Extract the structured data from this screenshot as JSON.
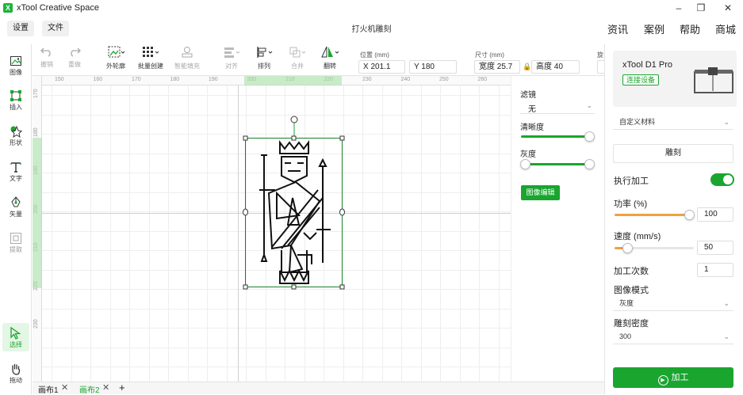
{
  "app": {
    "title": "xTool Creative Space",
    "logo_letter": "X"
  },
  "menubar": {
    "settings_label": "设置",
    "file_label": "文件",
    "document_title": "打火机雕刻",
    "links": [
      "资讯",
      "案例",
      "帮助",
      "商城"
    ]
  },
  "toolbar": {
    "undo_label": "撤销",
    "redo_label": "重做",
    "outline_label": "外轮廓",
    "batch_label": "批量创建",
    "smart_fill_label": "智能填充",
    "align_label": "对齐",
    "arrange_label": "排列",
    "combine_label": "合并",
    "flip_label": "翻转",
    "position_label": "位置 (mm)",
    "x_value": "X 201.1",
    "y_value": "Y 180",
    "size_label": "尺寸 (mm)",
    "width_value": "宽度 25.7",
    "height_value": "高度 40",
    "rotate_label_partial": "旋"
  },
  "leftbar": {
    "items": [
      {
        "label": "图像",
        "icon": "image-icon",
        "active": false,
        "disabled": false
      },
      {
        "label": "插入",
        "icon": "insert-icon",
        "active": false,
        "disabled": false
      },
      {
        "label": "形状",
        "icon": "shape-icon",
        "active": false,
        "disabled": false
      },
      {
        "label": "文字",
        "icon": "text-icon",
        "active": false,
        "disabled": false
      },
      {
        "label": "矢量",
        "icon": "pen-icon",
        "active": false,
        "disabled": false
      },
      {
        "label": "提取",
        "icon": "extract-icon",
        "active": false,
        "disabled": true
      },
      {
        "label": "选择",
        "icon": "cursor-icon",
        "active": true,
        "disabled": false
      },
      {
        "label": "拖动",
        "icon": "hand-icon",
        "active": false,
        "disabled": false
      }
    ]
  },
  "rulers": {
    "top": [
      "150",
      "160",
      "170",
      "180",
      "190",
      "200",
      "210",
      "220",
      "230",
      "240",
      "250",
      "260",
      "270"
    ],
    "left": [
      "170",
      "180",
      "190",
      "200",
      "210",
      "220",
      "230"
    ]
  },
  "filter_panel": {
    "filter_label": "滤镜",
    "filter_value": "无",
    "sharpness_label": "清晰度",
    "sharpness_level": 1.0,
    "gray_label": "灰度",
    "gray_range": [
      0.0,
      1.0
    ],
    "image_edit_label": "图像编辑"
  },
  "tabs": [
    {
      "label": "画布1",
      "active": false
    },
    {
      "label": "画布2",
      "active": true
    }
  ],
  "tab_add_label": "+",
  "right_panel": {
    "device_name": "xTool D1 Pro",
    "connect_label": "连接设备",
    "material_value": "自定义材料",
    "mode_label": "雕刻",
    "execute_label": "执行加工",
    "execute_on": true,
    "power_label": "功率 (%)",
    "power_value": "100",
    "speed_label": "速度 (mm/s)",
    "speed_value": "50",
    "passes_label": "加工次数",
    "passes_value": "1",
    "image_mode_label": "图像模式",
    "image_mode_value": "灰度",
    "density_label": "雕刻密度",
    "density_value": "300",
    "process_label": "加工"
  },
  "colors": {
    "accent": "#1aa52f"
  }
}
